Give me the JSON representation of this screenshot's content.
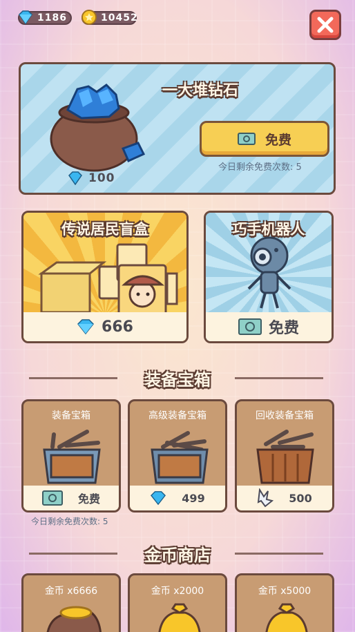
{
  "resources": {
    "diamonds": "1186",
    "coins": "10452"
  },
  "featured": {
    "title": "一大堆钻石",
    "button_label": "免费",
    "free_note": "今日剩余免费次数: 5",
    "amount": "100"
  },
  "cards": [
    {
      "title": "传说居民盲盒",
      "price": "666"
    },
    {
      "title": "巧手机器人",
      "price": "免费"
    }
  ],
  "equipment_section": {
    "title": "装备宝箱"
  },
  "chests": [
    {
      "name": "装备宝箱",
      "price": "免费"
    },
    {
      "name": "高级装备宝箱",
      "price": "499"
    },
    {
      "name": "回收装备宝箱",
      "price": "500"
    }
  ],
  "chest_note": "今日剩余免费次数: 5",
  "coin_section": {
    "title": "金币商店"
  },
  "coin_offers": [
    {
      "name": "金币 x6666"
    },
    {
      "name": "金币 x2000"
    },
    {
      "name": "金币 x5000"
    }
  ],
  "colors": {
    "accent_yellow": "#f7cf54",
    "close_red": "#f2695a",
    "panel_border": "#6b4a3e",
    "diamond_blue": "#39b6f0"
  },
  "icons": [
    "diamond-icon",
    "coin-icon",
    "close-icon",
    "ticket-icon",
    "crystal-shard-icon",
    "diamond-sack-icon",
    "mystery-box-icon",
    "robot-icon",
    "chest-icon",
    "coin-bag-icon"
  ]
}
